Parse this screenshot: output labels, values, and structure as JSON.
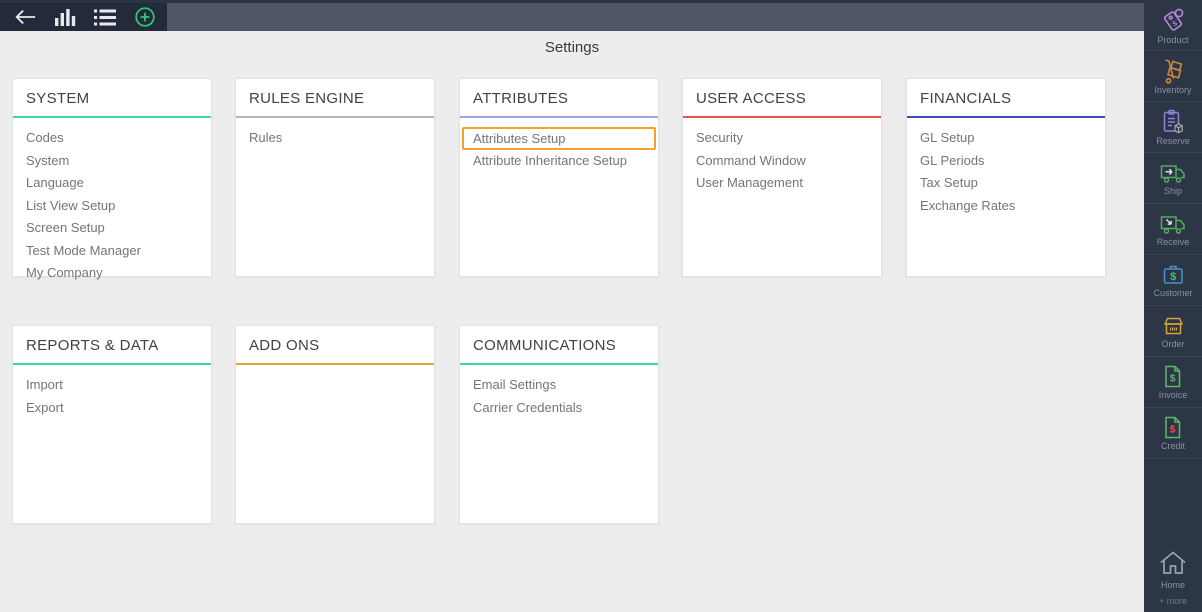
{
  "page": {
    "title": "Settings"
  },
  "topbar": {
    "icons": [
      "back-arrow-icon",
      "bar-chart-icon",
      "list-icon",
      "add-icon"
    ],
    "icon_color": "#e8eaed",
    "add_color": "#2ecc71"
  },
  "cards": [
    {
      "title": "SYSTEM",
      "accent": "#3fd6aa",
      "items": [
        "Codes",
        "System",
        "Language",
        "List View Setup",
        "Screen Setup",
        "Test Mode Manager",
        "My Company"
      ]
    },
    {
      "title": "RULES ENGINE",
      "accent": "#a9b5c8",
      "items": [
        "Rules"
      ]
    },
    {
      "title": "ATTRIBUTES",
      "accent": "#9da7e8",
      "items": [
        "Attributes Setup",
        "Attribute Inheritance Setup"
      ],
      "highlighted_item": "Attributes Setup",
      "highlight_color": "#f5a22d"
    },
    {
      "title": "USER ACCESS",
      "accent": "#e25749",
      "items": [
        "Security",
        "Command Window",
        "User Management"
      ]
    },
    {
      "title": "FINANCIALS",
      "accent": "#3c4eb0",
      "items": [
        "GL Setup",
        "GL Periods",
        "Tax Setup",
        "Exchange Rates"
      ]
    },
    {
      "title": "REPORTS & DATA",
      "accent": "#3fd6aa",
      "items": [
        "Import",
        "Export"
      ]
    },
    {
      "title": "ADD ONS",
      "accent": "#e6a23c",
      "items": []
    },
    {
      "title": "COMMUNICATIONS",
      "accent": "#3fd6aa",
      "items": [
        "Email Settings",
        "Carrier Credentials"
      ]
    }
  ],
  "sidebar": {
    "items": [
      {
        "label": "Product",
        "icon": "product-icon",
        "color": "#b485dc"
      },
      {
        "label": "Inventory",
        "icon": "inventory-icon",
        "color": "#c9873f"
      },
      {
        "label": "Reserve",
        "icon": "reserve-icon",
        "color": "#8d82d8"
      },
      {
        "label": "Ship",
        "icon": "ship-icon",
        "color": "#55ab62"
      },
      {
        "label": "Receive",
        "icon": "receive-icon",
        "color": "#55ab62"
      },
      {
        "label": "Customer",
        "icon": "customer-icon",
        "color": "#4a90c8"
      },
      {
        "label": "Order",
        "icon": "order-icon",
        "color": "#d2a53e"
      },
      {
        "label": "Invoice",
        "icon": "invoice-icon",
        "color": "#5cb96a"
      },
      {
        "label": "Credit",
        "icon": "credit-icon",
        "color": "#5cb96a"
      }
    ],
    "home": {
      "label": "Home",
      "icon": "home-icon",
      "color": "#9aa3ad"
    },
    "more_label": "+ more"
  }
}
